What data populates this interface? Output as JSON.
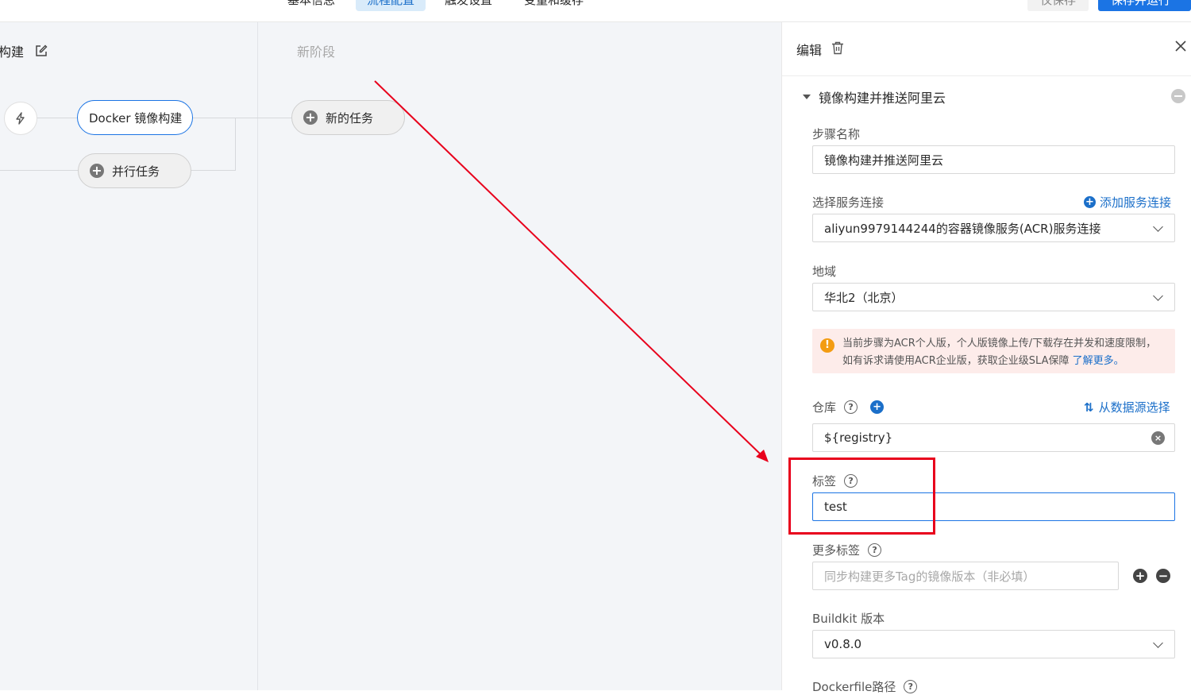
{
  "topbar": {
    "tabs": [
      {
        "label": "基本信息"
      },
      {
        "label": "流程配置"
      },
      {
        "label": "触发设置"
      },
      {
        "label": "变量和缓存"
      }
    ],
    "save_label": "仅保存",
    "save_run_label": "保存并运行"
  },
  "canvas": {
    "stage1": {
      "title": "构建",
      "job": "Docker 镜像构建",
      "parallel": "并行任务"
    },
    "stage2": {
      "title": "新阶段",
      "new_task": "新的任务"
    }
  },
  "panel": {
    "title": "编辑",
    "section_title": "镜像构建并推送阿里云",
    "step_name": {
      "label": "步骤名称",
      "value": "镜像构建并推送阿里云"
    },
    "service_conn": {
      "label": "选择服务连接",
      "add_link": "添加服务连接",
      "value": "aliyun9979144244的容器镜像服务(ACR)服务连接"
    },
    "region": {
      "label": "地域",
      "value": "华北2（北京）"
    },
    "warning": {
      "text": "当前步骤为ACR个人版，个人版镜像上传/下载存在并发和速度限制，如有诉求请使用ACR企业版，获取企业级SLA保障",
      "link": "了解更多。"
    },
    "repo": {
      "label": "仓库",
      "source_link": "从数据源选择",
      "value": "${registry}"
    },
    "tag": {
      "label": "标签",
      "value": "test"
    },
    "more_tags": {
      "label": "更多标签",
      "placeholder": "同步构建更多Tag的镜像版本（非必填）"
    },
    "buildkit": {
      "label": "Buildkit 版本",
      "value": "v0.8.0"
    },
    "dockerfile": {
      "label": "Dockerfile路径"
    }
  },
  "colors": {
    "accent": "#1b74e4",
    "annotation": "#e8001c",
    "warning_bg": "#fdecea"
  }
}
